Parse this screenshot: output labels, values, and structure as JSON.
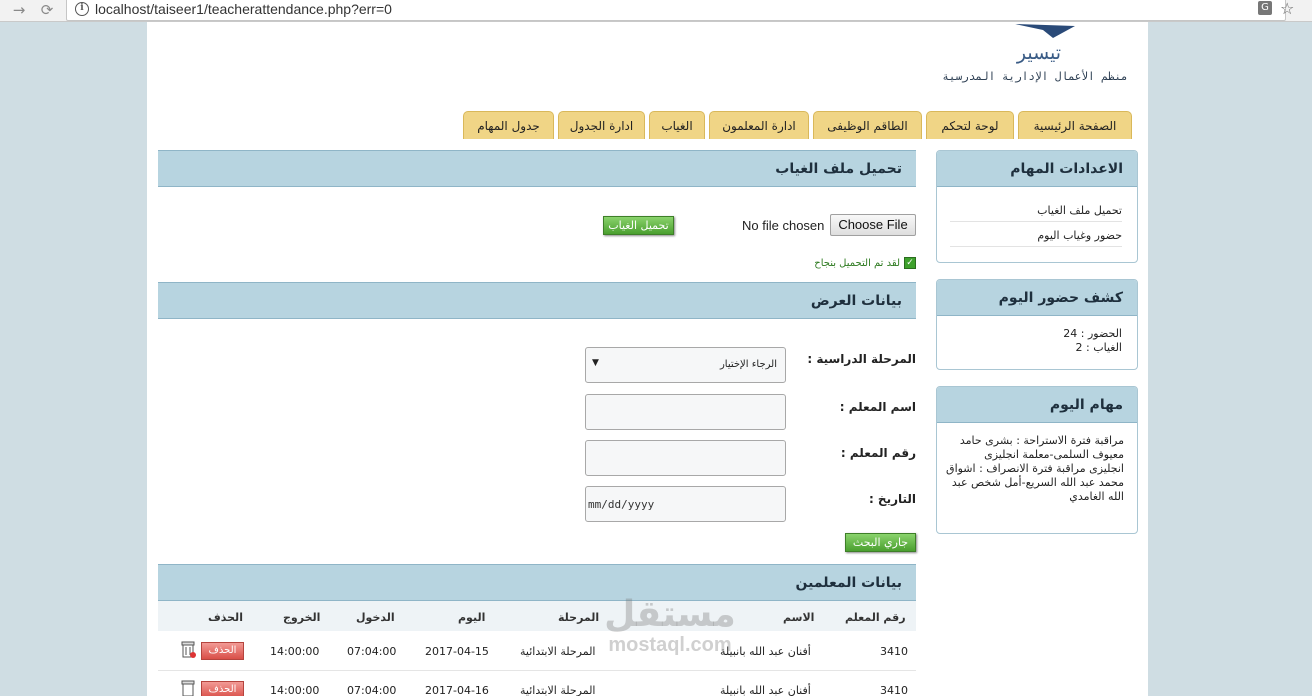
{
  "browser": {
    "url": "localhost/taiseer1/teacherattendance.php?err=0"
  },
  "logo": {
    "title": "تيسير",
    "subtitle": "منظم الأعمال الإدارية المدرسية"
  },
  "tabs": [
    {
      "label": "الصفحة الرئيسية"
    },
    {
      "label": "لوحة لتحكم"
    },
    {
      "label": "الطاقم الوظيفى"
    },
    {
      "label": "ادارة المعلمون"
    },
    {
      "label": "الغياب"
    },
    {
      "label": "ادارة الجدول"
    },
    {
      "label": "جدول المهام"
    }
  ],
  "sidebar": {
    "settings": {
      "title": "الاعدادات المهام",
      "links": [
        "تحميل ملف الغياب",
        "حضور وغياب اليوم"
      ]
    },
    "attendance": {
      "title": "كشف حضور اليوم",
      "present": "الحضور : 24",
      "absent": "الغياب : 2"
    },
    "tasks": {
      "title": "مهام اليوم",
      "text": "مراقبة فترة الاستراحة : بشرى حامد معيوف السلمى-معلمة انجليزى انجليزى مراقبة فترة الانصراف : اشواق محمد عبد الله السريع-أمل شخص عبد الله الغامدي"
    }
  },
  "upload": {
    "title": "تحميل ملف الغياب",
    "no_file": "No file chosen",
    "choose_file": "Choose File",
    "upload_button": "تحميل الغياب",
    "success": "لقد تم التحميل بنجاح"
  },
  "form": {
    "title": "بيانات العرض",
    "stage_label": "المرحلة الدراسية :",
    "stage_value": "الرجاء الإختيار",
    "teacher_name_label": "اسم المعلم :",
    "teacher_id_label": "رقم المعلم :",
    "date_label": "التاريخ :",
    "date_placeholder": "mm/dd/yyyy",
    "search_button": "جاري البحث"
  },
  "table": {
    "title": "بيانات المعلمين",
    "headers": {
      "id": "رقم المعلم",
      "name": "الاسم",
      "stage": "المرحلة",
      "day": "اليوم",
      "in": "الدخول",
      "out": "الخروج",
      "delete": "الحذف"
    },
    "rows": [
      {
        "id": "3410",
        "name": "أفنان عبد الله بانبيلة",
        "stage": "المرحلة الابتدائية",
        "day": "2017-04-15",
        "in": "07:04:00",
        "out": "14:00:00",
        "delete": "الحذف"
      },
      {
        "id": "3410",
        "name": "أفنان عبد الله بانبيلة",
        "stage": "المرحلة الابتدائية",
        "day": "2017-04-16",
        "in": "07:04:00",
        "out": "14:00:00",
        "delete": "الحذف"
      }
    ]
  },
  "watermark": {
    "line1": "مستقل",
    "line2": "mostaql.com"
  }
}
